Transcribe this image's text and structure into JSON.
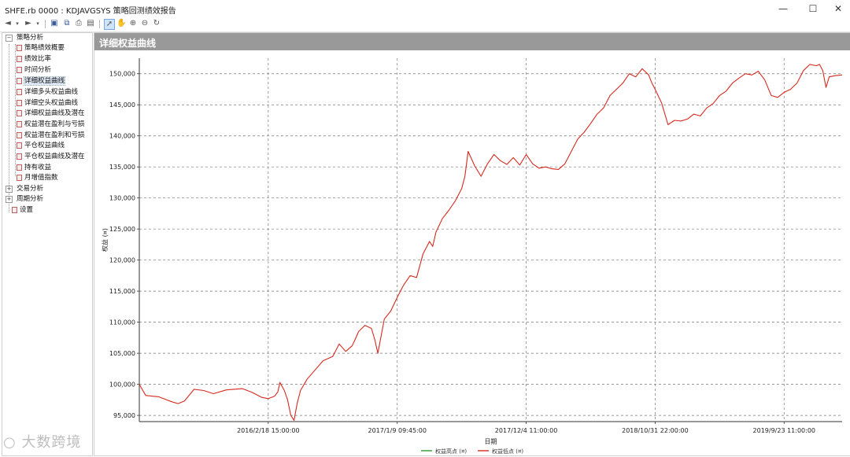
{
  "window": {
    "title": "SHFE.rb 0000 : KDJAVGSYS 策略回测绩效报告",
    "minimize": "—",
    "maximize": "☐",
    "close": "✕"
  },
  "toolbar": {
    "icons": [
      "back-arrow-icon",
      "dropdown-icon",
      "forward-arrow-icon",
      "dropdown-icon",
      "save-icon",
      "copy-icon",
      "print-icon",
      "preview-icon",
      "cursor-icon",
      "hand-icon",
      "zoom-in-icon",
      "zoom-out-icon",
      "refresh-icon"
    ]
  },
  "tree": {
    "groups": [
      {
        "label": "策略分析",
        "expanded": true,
        "children": [
          "策略绩效概要",
          "绩效比率",
          "时间分析",
          "详细权益曲线",
          "详细多头权益曲线",
          "详细空头权益曲线",
          "详细权益曲线及潜在",
          "权益潜在盈利与亏损",
          "权益潜在盈利和亏损",
          "平仓权益曲线",
          "平仓权益曲线及潜在",
          "持有收益",
          "月增值指数"
        ]
      },
      {
        "label": "交易分析",
        "expanded": false
      },
      {
        "label": "周期分析",
        "expanded": false
      },
      {
        "label": "设置",
        "leaf": true
      }
    ],
    "selected": "详细权益曲线"
  },
  "panel": {
    "title": "详细权益曲线"
  },
  "watermark": "大数跨境",
  "chart_data": {
    "type": "line",
    "title": "",
    "xlabel": "日期",
    "ylabel": "权益 (¤)",
    "ylim": [
      94000,
      152500
    ],
    "ytick_values": [
      95000,
      100000,
      105000,
      110000,
      115000,
      120000,
      125000,
      130000,
      135000,
      140000,
      145000,
      150000
    ],
    "ytick_labels": [
      "95,000",
      "100,000",
      "105,000",
      "110,000",
      "115,000",
      "120,000",
      "125,000",
      "130,000",
      "135,000",
      "140,000",
      "145,000",
      "150,000"
    ],
    "xtick_labels": [
      "2016/2/18 15:00:00",
      "2017/1/9 09:45:00",
      "2017/12/4 11:00:00",
      "2018/10/31 22:00:00",
      "2019/9/23 11:00:00"
    ],
    "xtick_positions": [
      0.2,
      0.4,
      0.6,
      0.8,
      1.0
    ],
    "xlim": [
      0,
      1.09
    ],
    "grid": true,
    "legend": [
      "权益高点 (¤)",
      "权益低点 (¤)"
    ],
    "legend_position": "bottom-center",
    "colors": {
      "high": "#2e9a2e",
      "low": "#d42a1f"
    },
    "series": [
      {
        "name": "权益低点 (¤)",
        "x": [
          0.0,
          0.01,
          0.03,
          0.05,
          0.06,
          0.07,
          0.085,
          0.1,
          0.115,
          0.135,
          0.16,
          0.175,
          0.19,
          0.2,
          0.21,
          0.215,
          0.218,
          0.225,
          0.23,
          0.235,
          0.24,
          0.245,
          0.25,
          0.26,
          0.27,
          0.285,
          0.3,
          0.31,
          0.32,
          0.33,
          0.335,
          0.34,
          0.35,
          0.36,
          0.365,
          0.37,
          0.38,
          0.39,
          0.4,
          0.41,
          0.42,
          0.43,
          0.44,
          0.45,
          0.455,
          0.46,
          0.47,
          0.48,
          0.49,
          0.5,
          0.505,
          0.51,
          0.52,
          0.53,
          0.54,
          0.55,
          0.56,
          0.57,
          0.58,
          0.59,
          0.6,
          0.61,
          0.62,
          0.63,
          0.64,
          0.65,
          0.66,
          0.67,
          0.68,
          0.69,
          0.7,
          0.71,
          0.72,
          0.73,
          0.74,
          0.75,
          0.76,
          0.77,
          0.78,
          0.79,
          0.795,
          0.8,
          0.81,
          0.82,
          0.83,
          0.84,
          0.85,
          0.86,
          0.87,
          0.88,
          0.89,
          0.9,
          0.91,
          0.92,
          0.93,
          0.94,
          0.95,
          0.96,
          0.97,
          0.98,
          0.99,
          1.0,
          1.01,
          1.02,
          1.03,
          1.04,
          1.05,
          1.055,
          1.06,
          1.065,
          1.07,
          1.08,
          1.09
        ],
        "values": [
          100000,
          98200,
          98000,
          97200,
          96900,
          97300,
          99200,
          99000,
          98500,
          99100,
          99300,
          98700,
          97900,
          97700,
          98100,
          98800,
          100300,
          99000,
          97500,
          95000,
          94200,
          97000,
          99000,
          100800,
          102000,
          103800,
          104500,
          106500,
          105300,
          106200,
          107300,
          108500,
          109500,
          109000,
          107300,
          105000,
          110500,
          111800,
          114000,
          116000,
          117500,
          117200,
          121000,
          123000,
          122200,
          124500,
          126700,
          128000,
          129500,
          131500,
          133500,
          137500,
          135200,
          133500,
          135500,
          137000,
          136000,
          135400,
          136500,
          135300,
          137000,
          135500,
          134800,
          135000,
          134700,
          134600,
          135500,
          137500,
          139500,
          140600,
          142000,
          143500,
          144500,
          146500,
          147500,
          148500,
          150000,
          149500,
          150800,
          149800,
          148500,
          147500,
          145300,
          141800,
          142500,
          142400,
          142700,
          143500,
          143200,
          144500,
          145200,
          146500,
          147200,
          148500,
          149300,
          150000,
          149800,
          150400,
          149000,
          146500,
          146200,
          147000,
          147500,
          148500,
          150500,
          151500,
          151300,
          151500,
          150500,
          147800,
          149500,
          149700,
          149800
        ]
      }
    ]
  }
}
